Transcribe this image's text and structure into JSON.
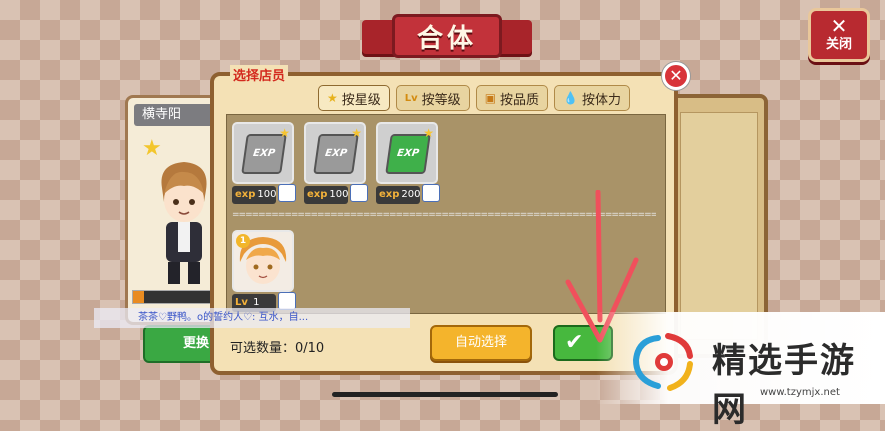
{
  "title": "合体",
  "close_button": {
    "label": "关闭",
    "icon": "close-icon"
  },
  "background_card": {
    "name": "横寺阳",
    "level_progress": 0.12
  },
  "background_button": {
    "label": "更换"
  },
  "dialog": {
    "title": "选择店员",
    "tabs": [
      {
        "label": "按星级",
        "icon": "star-icon",
        "active": true
      },
      {
        "label": "按等级",
        "icon": "level-icon",
        "active": false
      },
      {
        "label": "按品质",
        "icon": "quality-icon",
        "active": false
      },
      {
        "label": "按体力",
        "icon": "droplet-icon",
        "active": false
      }
    ],
    "items": [
      {
        "type": "exp-book",
        "tag": "exp",
        "value": "100",
        "color": "#9a9a9a",
        "label": "EXP"
      },
      {
        "type": "exp-book",
        "tag": "exp",
        "value": "100",
        "color": "#9a9a9a",
        "label": "EXP"
      },
      {
        "type": "exp-book",
        "tag": "exp",
        "value": "200",
        "color": "#3fb04a",
        "label": "EXP"
      },
      {
        "type": "character",
        "tag": "Lv",
        "value": "1",
        "badge": "1"
      }
    ],
    "separator": "====================================================================",
    "count_label": "可选数量：0/10",
    "auto_select_label": "自动选择",
    "confirm_icon": "check-icon"
  },
  "chat_message": "茶茶♡野鸭。o的誓约人♡: 互水，自...",
  "watermark": {
    "text": "精选手游网",
    "url": "www.tzymjx.net"
  }
}
